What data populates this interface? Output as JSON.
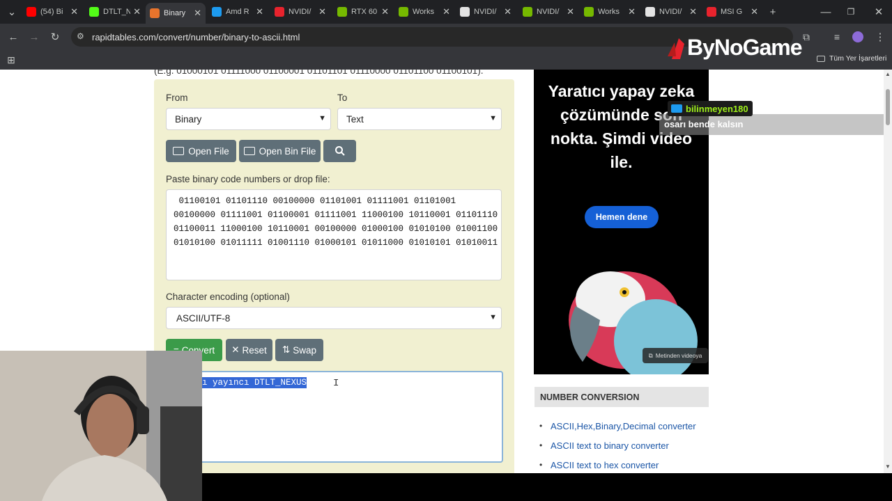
{
  "browser": {
    "tabs": [
      {
        "title": "(54) Bi",
        "fav_color": "#ff0000"
      },
      {
        "title": "DTLT_N",
        "fav_color": "#53fc18"
      },
      {
        "title": "Binary",
        "fav_color": "#e8742c"
      },
      {
        "title": "Amd R",
        "fav_color": "#1d9bf0"
      },
      {
        "title": "NVIDI/",
        "fav_color": "#e8232d"
      },
      {
        "title": "RTX 60",
        "fav_color": "#76b900"
      },
      {
        "title": "Works",
        "fav_color": "#76b900"
      },
      {
        "title": "NVIDI/",
        "fav_color": "#e3e3e3"
      },
      {
        "title": "NVIDI/",
        "fav_color": "#76b900"
      },
      {
        "title": "Works",
        "fav_color": "#76b900"
      },
      {
        "title": "NVIDI/",
        "fav_color": "#e3e3e3"
      },
      {
        "title": "MSI G",
        "fav_color": "#e8232d"
      }
    ],
    "url": "rapidtables.com/convert/number/binary-to-ascii.html",
    "bookmarks_label": "Tüm Yer İşaretleri"
  },
  "overlay": {
    "logo_text": "ByNoGame",
    "chat_user": "bilinmeyen180",
    "chat_msg": "osarı bende kalsın"
  },
  "page": {
    "example_text": "(E.g. 01000101 01111000 01100001 01101101 01110000 01101100 01100101).",
    "from_label": "From",
    "from_value": "Binary",
    "to_label": "To",
    "to_value": "Text",
    "open_file": "Open File",
    "open_bin_file": "Open Bin File",
    "paste_label": "Paste binary code numbers or drop file:",
    "binary_lines": [
      " 01100101 01101110 00100000 01101001 01111001 01101001",
      "00100000 01111001 01100001 01111001 11000100 10110001 01101110",
      "01100011 11000100 10110001 00100000 01000100 01010100 01001100",
      "01010100 01011111 01001110 01000101 01011000 01010101 01010011"
    ],
    "encoding_label": "Character encoding (optional)",
    "encoding_value": "ASCII/UTF-8",
    "convert": "Convert",
    "reset": "Reset",
    "swap": "Swap",
    "output_visible": "ı yayıncı DTLT_NEXUS"
  },
  "ad": {
    "headline": "Yaratıcı yapay zeka çözümünde son nokta. Şimdi video ile.",
    "cta": "Hemen dene",
    "badge": "Metinden videoya"
  },
  "sidebar": {
    "section_title": "NUMBER CONVERSION",
    "links": [
      "ASCII,Hex,Binary,Decimal converter",
      "ASCII text to binary converter",
      "ASCII text to hex converter"
    ]
  }
}
